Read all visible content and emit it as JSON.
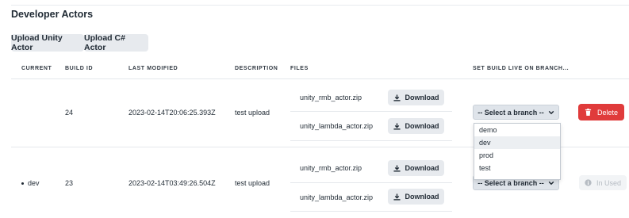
{
  "page": {
    "title": "Developer Actors"
  },
  "actions": {
    "upload_unity": "Upload Unity Actor",
    "upload_csharp": "Upload C# Actor"
  },
  "table": {
    "headers": [
      "CURRENT",
      "BUILD ID",
      "LAST MODIFIED",
      "DESCRIPTION",
      "FILES",
      "SET BUILD LIVE ON BRANCH..."
    ],
    "rows": [
      {
        "current": "",
        "build_id": "24",
        "last_modified": "2023-02-14T20:06:25.393Z",
        "description": "test upload",
        "files": [
          {
            "name": "unity_rmb_actor.zip",
            "action": "Download"
          },
          {
            "name": "unity_lambda_actor.zip",
            "action": "Download"
          }
        ],
        "branch_select": "-- Select a branch --",
        "action": "Delete"
      },
      {
        "current": "dev",
        "build_id": "23",
        "last_modified": "2023-02-14T03:49:26.504Z",
        "description": "test upload",
        "files": [
          {
            "name": "unity_rmb_actor.zip",
            "action": "Download"
          },
          {
            "name": "unity_lambda_actor.zip",
            "action": "Download"
          }
        ],
        "branch_select": "-- Select a branch --",
        "action": "In Used"
      }
    ]
  },
  "branch_dropdown": {
    "options": [
      "demo",
      "dev",
      "prod",
      "test"
    ],
    "highlighted": "dev"
  },
  "colors": {
    "delete": "#e03b3b",
    "button_bg": "#e7eaee",
    "select_bg": "#dfe4ea"
  },
  "icons": {
    "download": "download-icon",
    "select": "chevron-down-icon",
    "delete": "trash-icon",
    "in_used": "info-icon"
  }
}
